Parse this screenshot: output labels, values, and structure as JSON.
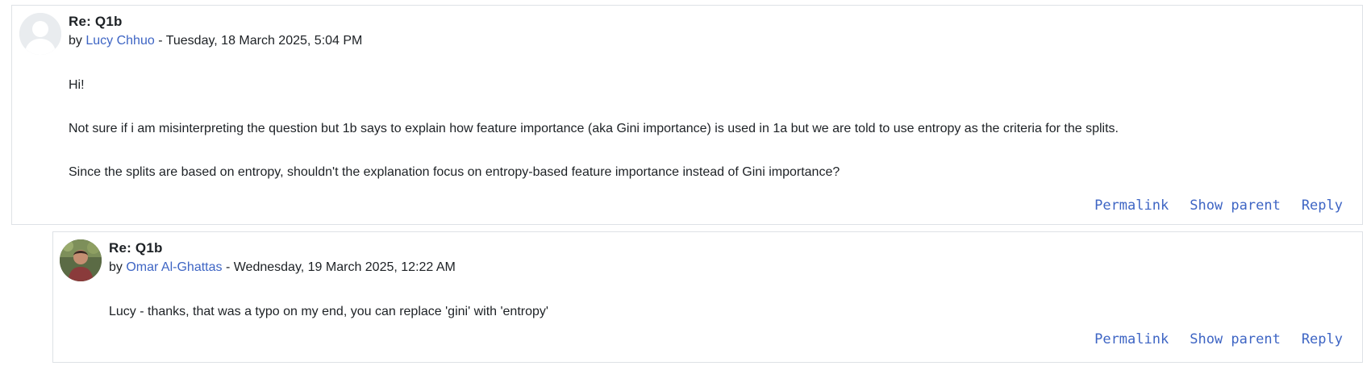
{
  "posts": [
    {
      "subject": "Re: Q1b",
      "by_prefix": "by",
      "author": "Lucy Chhuo",
      "date_sep": " - ",
      "date": "Tuesday, 18 March 2025, 5:04 PM",
      "avatar_icon": "default-user-avatar-icon",
      "paragraphs": [
        "Hi!",
        "Not sure if i am misinterpreting the question but 1b says to explain how feature importance (aka Gini importance) is used in 1a but we are told to use entropy as the criteria for the splits.",
        "Since the splits are based on entropy, shouldn't the explanation focus on entropy-based feature importance instead of Gini importance?"
      ],
      "actions": {
        "permalink": "Permalink",
        "show_parent": "Show parent",
        "reply": "Reply"
      }
    },
    {
      "subject": "Re: Q1b",
      "by_prefix": "by",
      "author": "Omar Al-Ghattas",
      "date_sep": " - ",
      "date": "Wednesday, 19 March 2025, 12:22 AM",
      "avatar_icon": "user-photo-avatar-icon",
      "paragraphs": [
        "Lucy - thanks, that was a typo on my end, you can replace 'gini' with 'entropy'"
      ],
      "actions": {
        "permalink": "Permalink",
        "show_parent": "Show parent",
        "reply": "Reply"
      }
    }
  ],
  "colors": {
    "link": "#3e65c4",
    "text": "#1d2125",
    "border": "#dee2e6"
  }
}
